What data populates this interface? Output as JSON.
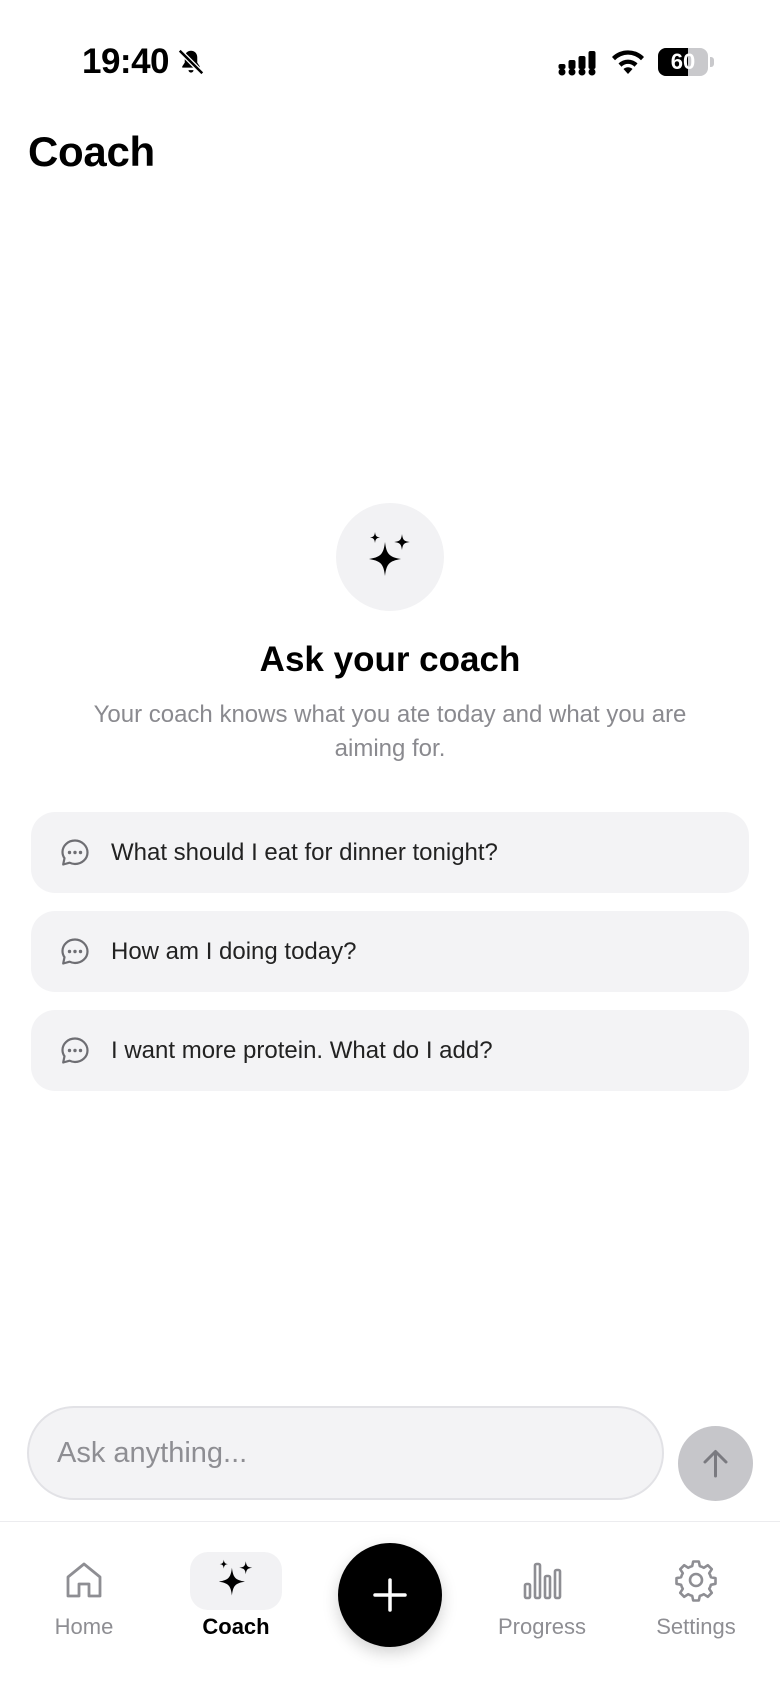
{
  "status_bar": {
    "time": "19:40",
    "battery_level": 60,
    "icons": [
      "bell-slash-icon",
      "cellular-signal-icon",
      "wifi-icon",
      "battery-icon"
    ]
  },
  "header": {
    "title": "Coach"
  },
  "hero": {
    "icon": "sparkles-icon",
    "title": "Ask your coach",
    "subtitle": "Your coach knows what you ate today and what you are aiming for."
  },
  "suggestions": [
    {
      "icon": "chat-bubble-icon",
      "text": "What should I eat for dinner tonight?"
    },
    {
      "icon": "chat-bubble-icon",
      "text": "How am I doing today?"
    },
    {
      "icon": "chat-bubble-icon",
      "text": "I want more protein. What do I add?"
    }
  ],
  "composer": {
    "value": "",
    "placeholder": "Ask anything...",
    "send_icon": "arrow-up-icon"
  },
  "tab_bar": {
    "tabs": [
      {
        "label": "Home",
        "icon": "house-icon",
        "active": false
      },
      {
        "label": "Coach",
        "icon": "sparkles-icon",
        "active": true
      },
      {
        "label": "Progress",
        "icon": "bar-chart-icon",
        "active": false
      },
      {
        "label": "Settings",
        "icon": "gear-icon",
        "active": false
      }
    ],
    "fab_icon": "plus-icon"
  },
  "colors": {
    "accent": "#000000",
    "muted_text": "#8a8a8f",
    "card_background": "#f3f3f5",
    "send_button_disabled": "#c6c6ca"
  }
}
